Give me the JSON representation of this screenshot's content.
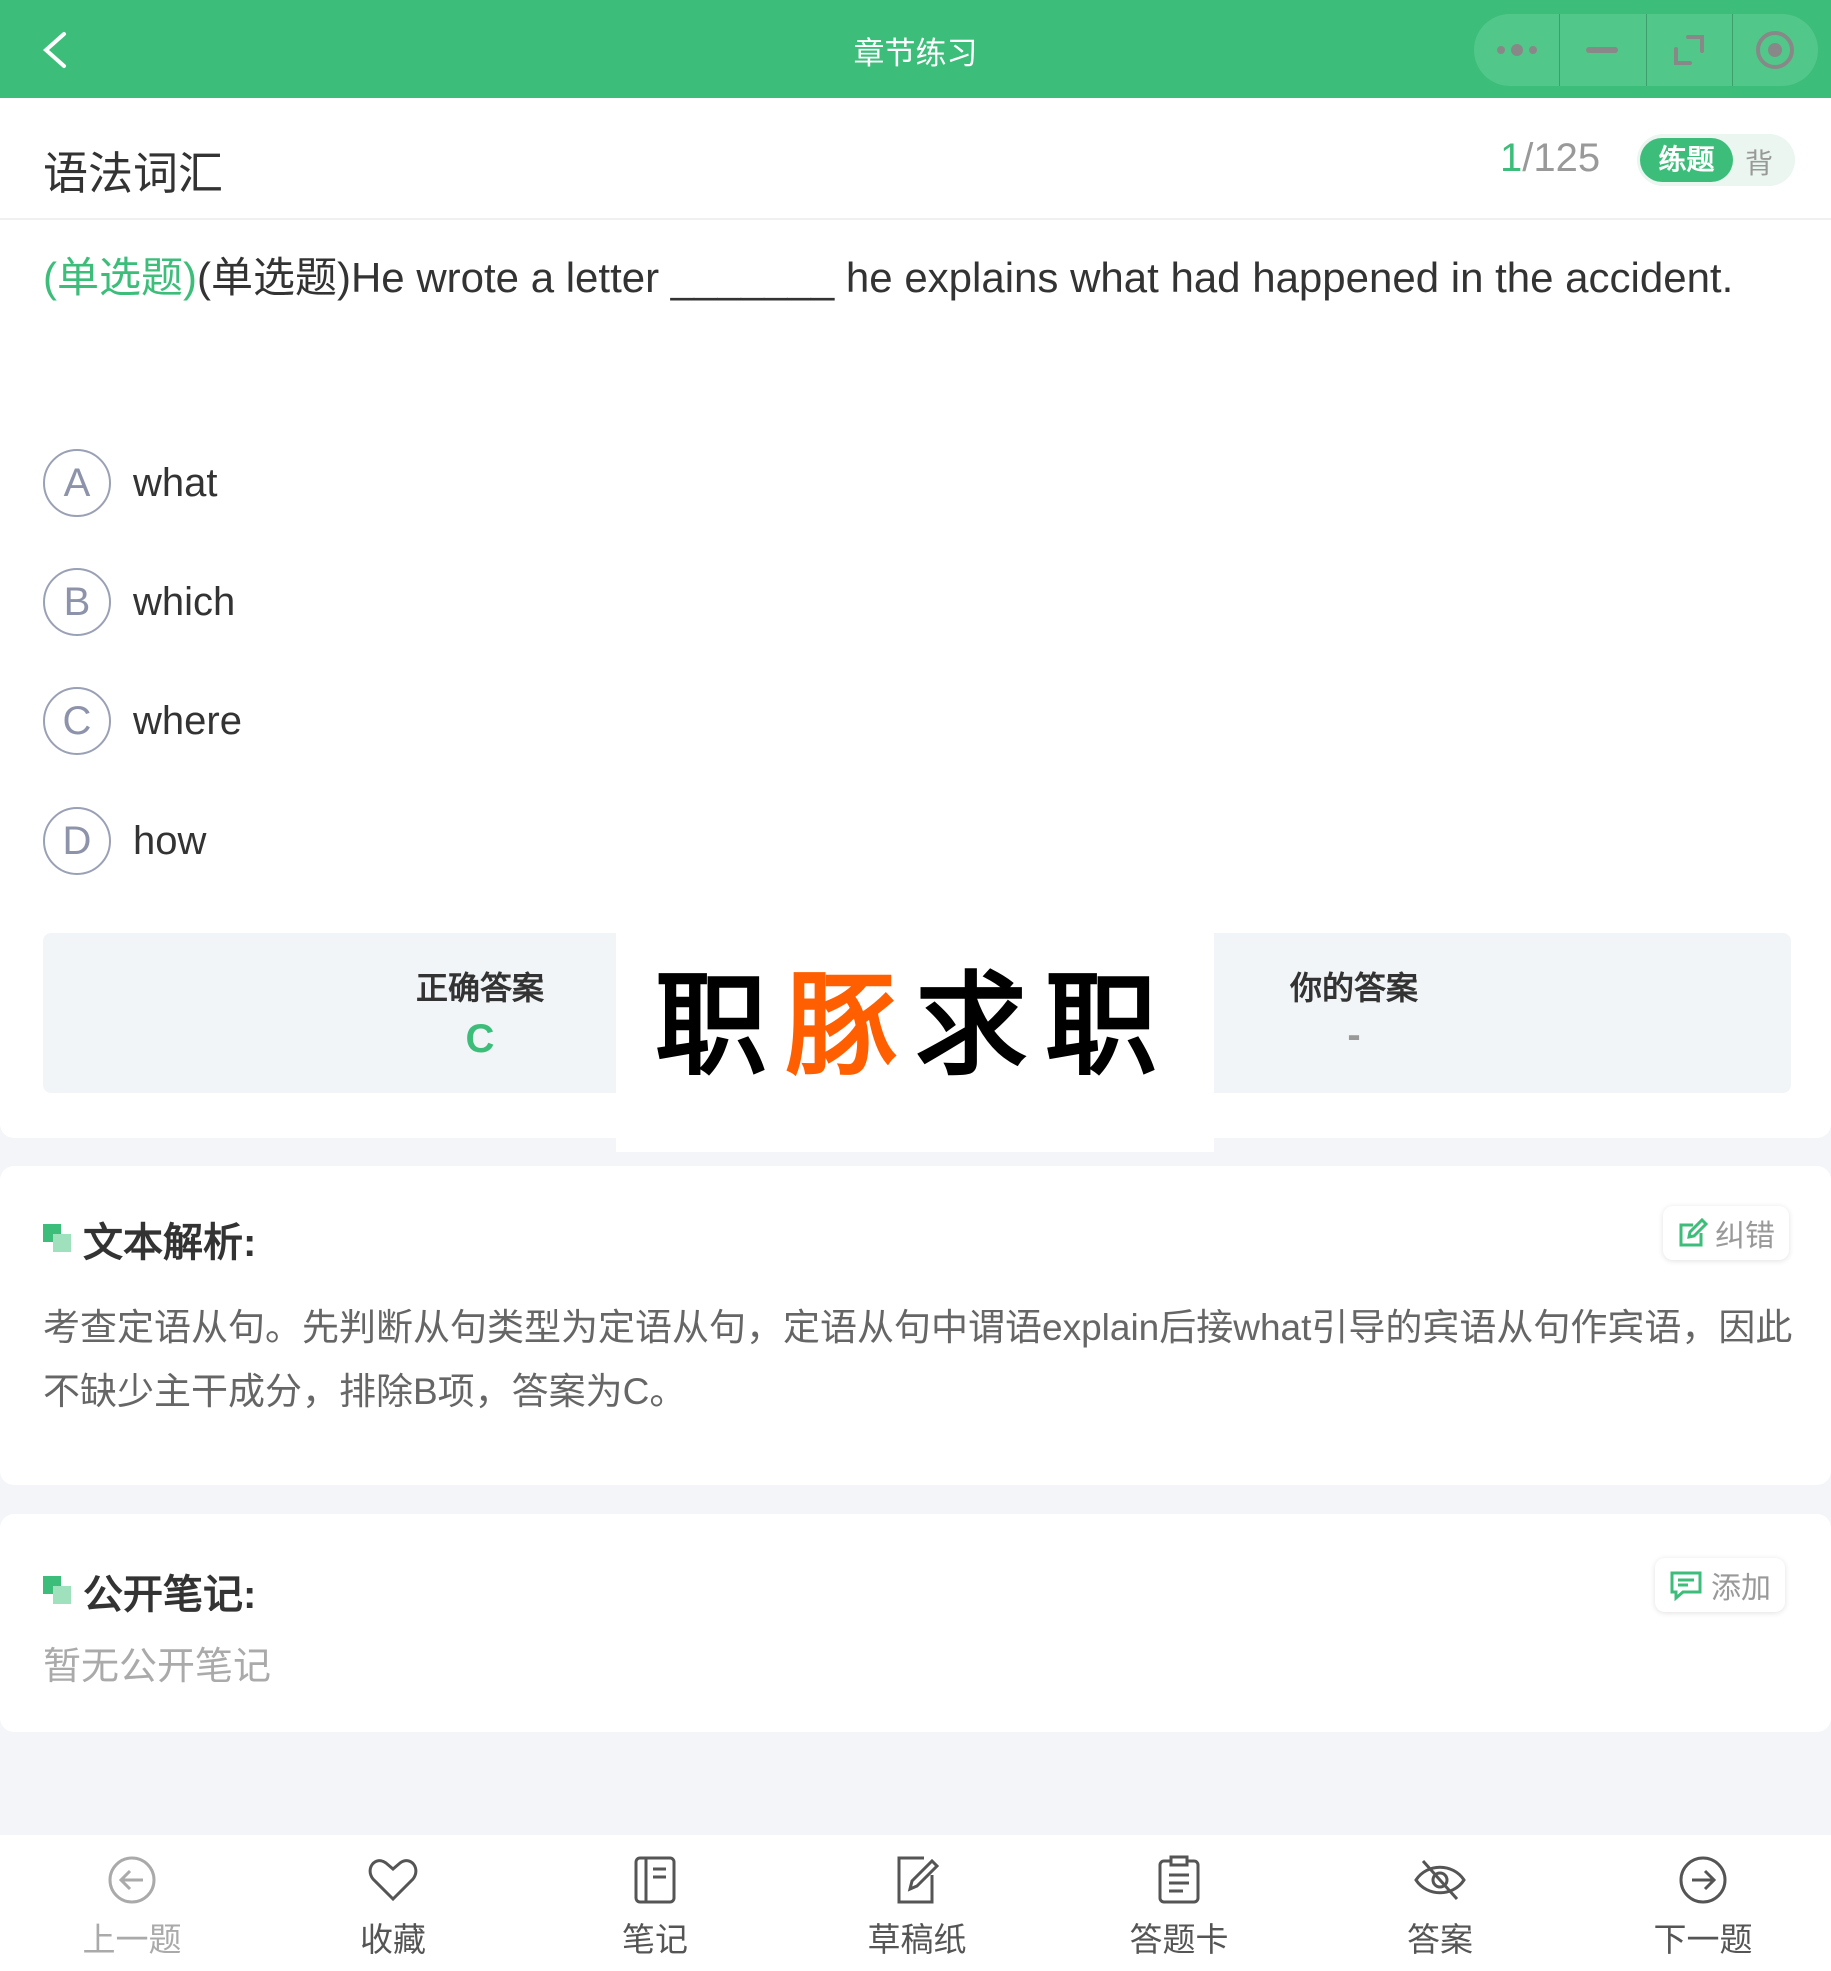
{
  "header": {
    "title": "章节练习",
    "back_icon": "chevron-left-icon",
    "capsule": [
      "more-icon",
      "minimize-icon",
      "expand-icon",
      "record-icon"
    ],
    "color": "#3cbe7a"
  },
  "section": {
    "title": "语法词汇",
    "current": "1",
    "total": "/125",
    "mode_active": "练题",
    "mode_other": "背"
  },
  "question": {
    "type_tag": "(单选题)",
    "text": "(单选题)He wrote a letter _______ he explains what had happened in the accident.",
    "options": [
      {
        "letter": "A",
        "text": "what"
      },
      {
        "letter": "B",
        "text": "which"
      },
      {
        "letter": "C",
        "text": "where"
      },
      {
        "letter": "D",
        "text": "how"
      }
    ]
  },
  "answer": {
    "correct_label": "正确答案",
    "correct_value": "C",
    "yours_label": "你的答案",
    "yours_value": "-"
  },
  "logo": {
    "chars": [
      "职",
      "豚",
      "求",
      "职"
    ]
  },
  "analysis": {
    "heading": "文本解析:",
    "button": "纠错",
    "text": "考查定语从句。先判断从句类型为定语从句，定语从句中谓语explain后接what引导的宾语从句作宾语，因此不缺少主干成分，排除B项，答案为C。"
  },
  "notes": {
    "heading": "公开笔记:",
    "button": "添加",
    "empty": "暂无公开笔记"
  },
  "bottom_bar": [
    {
      "label": "上一题",
      "icon": "arrow-left-circle-icon"
    },
    {
      "label": "收藏",
      "icon": "heart-icon"
    },
    {
      "label": "笔记",
      "icon": "notebook-icon"
    },
    {
      "label": "草稿纸",
      "icon": "draft-icon"
    },
    {
      "label": "答题卡",
      "icon": "clipboard-icon"
    },
    {
      "label": "答案",
      "icon": "eye-off-icon"
    },
    {
      "label": "下一题",
      "icon": "arrow-right-circle-icon"
    }
  ]
}
